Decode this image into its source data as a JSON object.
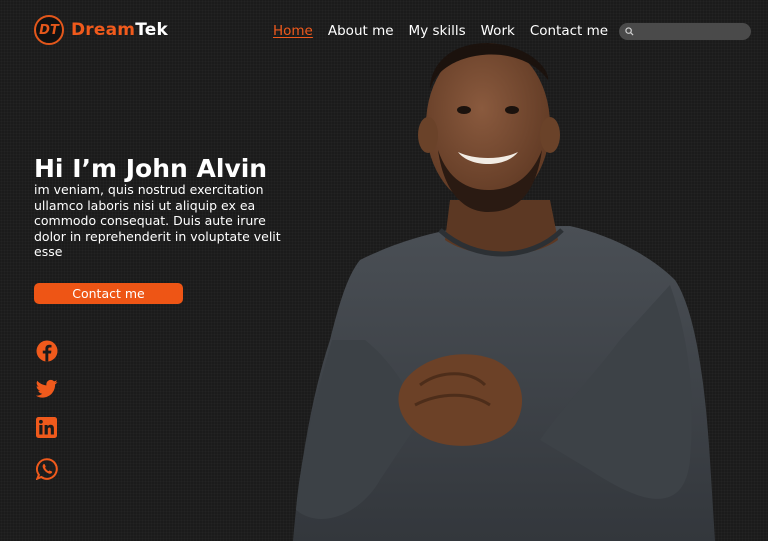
{
  "brand": {
    "name_part1": "Dream",
    "name_part2": "Tek",
    "logo_initials": "DT"
  },
  "nav": {
    "items": [
      {
        "label": "Home",
        "active": true
      },
      {
        "label": "About me"
      },
      {
        "label": "My skills"
      },
      {
        "label": "Work"
      },
      {
        "label": "Contact me"
      }
    ]
  },
  "search": {
    "placeholder": "",
    "value": ""
  },
  "hero": {
    "title": "Hi I’m John Alvin",
    "text": "im veniam, quis nostrud exercitation ullamco laboris nisi ut aliquip ex ea commodo consequat. Duis aute irure dolor in reprehenderit in voluptate velit esse",
    "cta_label": "Contact me"
  },
  "social": [
    "facebook-icon",
    "twitter-icon",
    "linkedin-icon",
    "whatsapp-icon"
  ],
  "colors": {
    "accent": "#f05a1c",
    "background": "#1b1b1b",
    "search_bg": "#4a4a4a"
  }
}
